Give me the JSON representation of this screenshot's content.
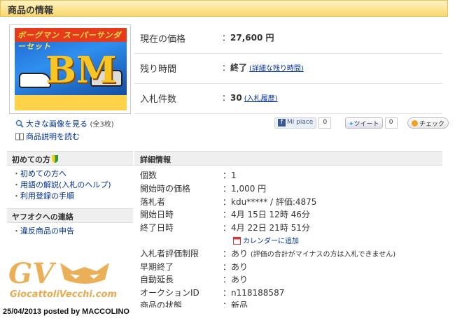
{
  "header": {
    "title": "商品の情報"
  },
  "product": {
    "box_banner": "ボーグマン スーパーサンダーセット",
    "box_logo": "BM",
    "view_large_link": "大きな画像を見る",
    "view_large_count": "(全3枚)",
    "read_description_link": "商品説明を読む"
  },
  "price_panel": {
    "rows": [
      {
        "label": "現在の価格",
        "value": "27,600 円",
        "sub": ""
      },
      {
        "label": "残り時間",
        "value": "終了",
        "sub": "(詳細な残り時間)"
      },
      {
        "label": "入札件数",
        "value": "30",
        "sub": "(入札履歴)"
      }
    ]
  },
  "social": {
    "facebook_label": "Mi piace",
    "facebook_count": "0",
    "twitter_label": "ツイート",
    "twitter_count": "0",
    "check_label": "チェック"
  },
  "sidebar": {
    "beginner": {
      "title": "初めての方",
      "items": [
        "初めての方へ",
        "用語の解説(入札のヘルプ)",
        "利用登録の手順"
      ]
    },
    "contact": {
      "title": "ヤフオクへの連絡",
      "items": [
        "違反商品の申告"
      ]
    }
  },
  "details": {
    "title": "詳細情報",
    "rows": [
      {
        "key": "個数",
        "value": "1"
      },
      {
        "key": "開始時の価格",
        "value": "1,000 円"
      },
      {
        "key": "落札者",
        "value": "kdu***** / 評価:4875"
      },
      {
        "key": "開始日時",
        "value": "4月 15日 12時 46分"
      },
      {
        "key": "終了日時",
        "value": "4月 22日 21時 51分"
      },
      {
        "key": "入札者評価制限",
        "value": "あり",
        "note": "(評価の合計がマイナスの方は入札できません)"
      },
      {
        "key": "早期終了",
        "value": "あり"
      },
      {
        "key": "自動延長",
        "value": "あり"
      },
      {
        "key": "オークションID",
        "value": "n118188587"
      },
      {
        "key": "商品の状態",
        "value": "新品"
      }
    ],
    "calendar_link": "カレンダーに追加"
  },
  "watermark": {
    "logo": "GV",
    "url": "GiocattoliVecchi.com"
  },
  "footer": {
    "posted": "25/04/2013 posted by MACCOLINO"
  },
  "colors": {
    "link": "#00329e",
    "header_bg": "#f9d86c",
    "watermark": "#e8a23a"
  }
}
